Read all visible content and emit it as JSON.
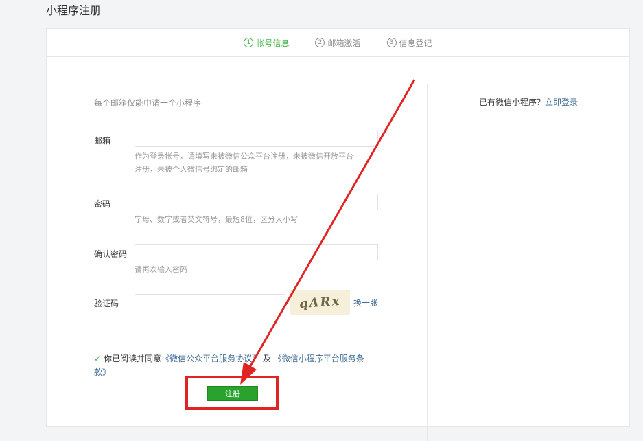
{
  "page": {
    "title": "小程序注册"
  },
  "steps": [
    {
      "num": "1",
      "label": "帐号信息",
      "active": true
    },
    {
      "num": "2",
      "label": "邮箱激活",
      "active": false
    },
    {
      "num": "3",
      "label": "信息登记",
      "active": false
    }
  ],
  "steps_separator": "——",
  "form": {
    "hint": "每个邮箱仅能申请一个小程序",
    "email": {
      "label": "邮箱",
      "value": "",
      "desc_line1": "作为登录帐号，请填写未被微信公众平台注册，未被微信开放平台",
      "desc_line2": "注册，未被个人微信号绑定的邮箱"
    },
    "password": {
      "label": "密码",
      "value": "",
      "desc": "字母、数字或者英文符号，最短8位，区分大小写"
    },
    "confirm": {
      "label": "确认密码",
      "value": "",
      "desc": "请再次输入密码"
    },
    "captcha": {
      "label": "验证码",
      "value": "",
      "image_text": "qARx",
      "refresh": "换一张"
    },
    "agreement": {
      "prefix": "你已阅读并同意",
      "link1": "《微信公众平台服务协议》",
      "middle": "及",
      "link2": "《微信小程序平台服务条款》"
    },
    "submit": "注册"
  },
  "login": {
    "text": "已有微信小程序？",
    "link": "立即登录"
  },
  "colors": {
    "accent": "#44b549",
    "link": "#3f6b96",
    "annotation": "#e02424"
  },
  "icons": {
    "check": "check-icon",
    "step": "circled-number-icon"
  }
}
